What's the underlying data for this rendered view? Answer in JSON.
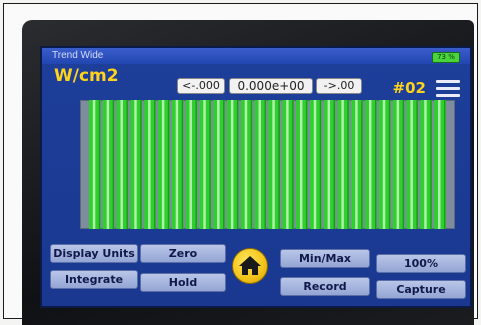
{
  "window": {
    "title": "Trend Wide"
  },
  "status": {
    "battery_text": "73 %"
  },
  "readout": {
    "units": "W/cm2",
    "prev_label": "<-.000",
    "value": "0.000e+00",
    "next_label": "->.00",
    "channel": "#02"
  },
  "trend": {
    "bar_count": 26,
    "colors": {
      "bar": "#2fcf2f",
      "bar_highlight": "#c8f5c0",
      "background": "#7f8c9e"
    }
  },
  "buttons": {
    "display_units": "Display Units",
    "zero": "Zero",
    "min_max": "Min/Max",
    "zoom": "100%",
    "integrate": "Integrate",
    "hold": "Hold",
    "record": "Record",
    "capture": "Capture"
  },
  "icons": {
    "home": "home-icon",
    "menu": "hamburger-menu-icon"
  },
  "colors": {
    "screen": "#1d3e9a",
    "accent_text": "#ffd21c"
  }
}
